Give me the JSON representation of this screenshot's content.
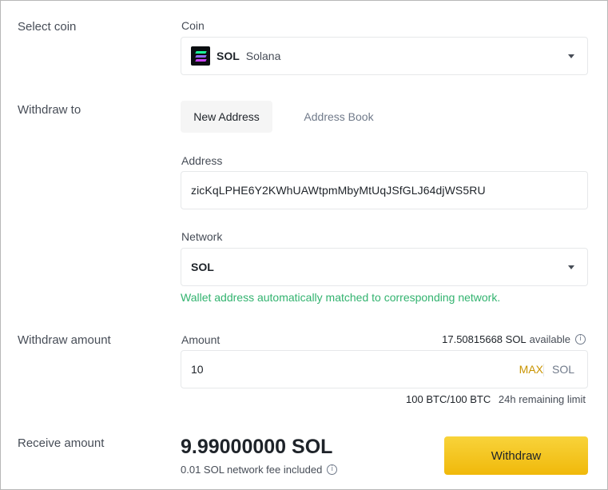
{
  "rows": {
    "select_coin": "Select coin",
    "withdraw_to": "Withdraw to",
    "withdraw_amount": "Withdraw amount",
    "receive_amount": "Receive amount"
  },
  "coin": {
    "label": "Coin",
    "symbol": "SOL",
    "name": "Solana",
    "icon": "solana-logo-icon"
  },
  "tabs": {
    "new_address": "New Address",
    "address_book": "Address Book",
    "active": "New Address"
  },
  "address": {
    "label": "Address",
    "value": "zicKqLPHE6Y2KWhUAWtpmMbyMtUqJSfGLJ64djWS5RU"
  },
  "network": {
    "label": "Network",
    "value": "SOL",
    "hint": "Wallet address automatically matched to corresponding network."
  },
  "amount": {
    "label": "Amount",
    "available_value": "17.50815668 SOL",
    "available_suffix": "available",
    "value": "10",
    "max_label": "MAX",
    "unit": "SOL",
    "limit_value": "100 BTC/100 BTC",
    "limit_suffix": "24h remaining limit"
  },
  "receive": {
    "amount": "9.99000000 SOL",
    "fee_note": "0.01 SOL network fee included"
  },
  "actions": {
    "withdraw_label": "Withdraw"
  },
  "colors": {
    "accent": "#f0b90b",
    "success": "#32b36f",
    "max": "#c99400"
  }
}
